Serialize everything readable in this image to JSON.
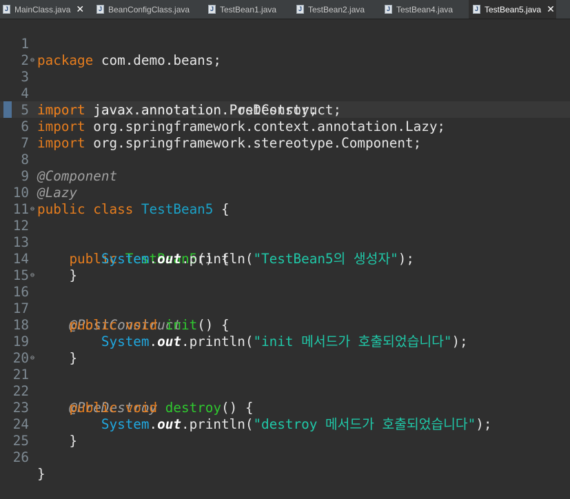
{
  "tabs": [
    {
      "label": "MainClass.java",
      "active": false,
      "closable": true
    },
    {
      "label": "BeanConfigClass.java",
      "active": false,
      "closable": false
    },
    {
      "label": "TestBean1.java",
      "active": false,
      "closable": false
    },
    {
      "label": "TestBean2.java",
      "active": false,
      "closable": false
    },
    {
      "label": "TestBean4.java",
      "active": false,
      "closable": false
    },
    {
      "label": "TestBean5.java",
      "active": true,
      "closable": true
    }
  ],
  "file_icon_glyph": "J",
  "close_glyph": "✕",
  "fold_glyph": "⊖",
  "code": {
    "l1": {
      "n": "1",
      "kw": "package",
      "rest": " com.demo.beans;"
    },
    "l2": {
      "n": "2"
    },
    "l3": {
      "n": "3",
      "kw": "import",
      "rest": " javax.annotation.PostConstruct;"
    },
    "l4": {
      "n": "4",
      "kw": "import",
      "rest": " javax.annotation.PreDestroy;"
    },
    "l5": {
      "n": "5",
      "kw": "import",
      "rest": " org.springframework.context.annotation.Lazy;"
    },
    "l6": {
      "n": "6",
      "kw": "import",
      "rest": " org.springframework.stereotype.Component;"
    },
    "l7": {
      "n": "7"
    },
    "l8": {
      "n": "8",
      "ann": "@Component"
    },
    "l9": {
      "n": "9",
      "ann": "@Lazy"
    },
    "l10": {
      "n": "10",
      "kw1": "public",
      "kw2": "class",
      "cls": "TestBean5",
      "rest": " {"
    },
    "l11": {
      "n": "11"
    },
    "l12": {
      "n": "12",
      "kw": "public",
      "mth": "TestBean5",
      "rest": "() {"
    },
    "l13": {
      "n": "13",
      "sys": "System",
      "out": "out",
      "mid": ".println(",
      "str": "\"TestBean5의 생성자\"",
      "end": ");"
    },
    "l14": {
      "n": "14",
      "text": "}"
    },
    "l15": {
      "n": "15"
    },
    "l16": {
      "n": "16",
      "ann": "@PostConstruct"
    },
    "l17": {
      "n": "17",
      "kw1": "public",
      "kw2": "void",
      "mth": "init",
      "rest": "() {"
    },
    "l18": {
      "n": "18",
      "sys": "System",
      "out": "out",
      "mid": ".println(",
      "str": "\"init 메서드가 호출되었습니다\"",
      "end": ");"
    },
    "l19": {
      "n": "19",
      "text": "}"
    },
    "l20": {
      "n": "20"
    },
    "l21": {
      "n": "21",
      "ann": "@PreDestroy"
    },
    "l22": {
      "n": "22",
      "kw1": "public",
      "kw2": "void",
      "mth": "destroy",
      "rest": "() {"
    },
    "l23": {
      "n": "23",
      "sys": "System",
      "out": "out",
      "mid": ".println(",
      "str": "\"destroy 메서드가 호출되었습니다\"",
      "end": ");"
    },
    "l24": {
      "n": "24",
      "text": "}"
    },
    "l25": {
      "n": "25"
    },
    "l26": {
      "n": "26",
      "text": "}"
    }
  }
}
